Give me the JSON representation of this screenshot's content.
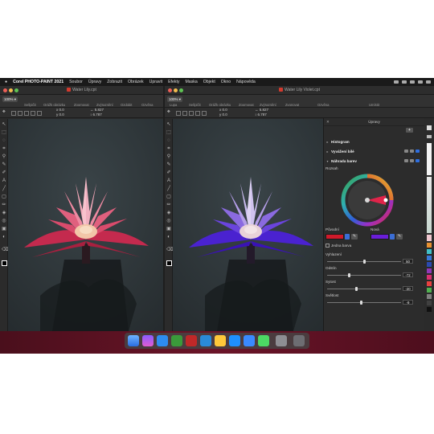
{
  "menubar": {
    "app_name": "Corel PHOTO-PAINT 2021",
    "items": [
      "Soubor",
      "Úpravy",
      "Zobrazit",
      "Obrázek",
      "Upravit",
      "Efekty",
      "Maska",
      "Objekt",
      "Okno",
      "Nápověda"
    ]
  },
  "left_window": {
    "title": "Water Lily.cpt",
    "zoom": "100%",
    "toolbar_labels": [
      "Sešpičit",
      "Orážk obrázku",
      "Zoomovat",
      "Zvýraznění",
      "Ozdobit",
      "Ozvěna"
    ],
    "props": {
      "x": "0.0",
      "y": "0.0",
      "w": "5.827",
      "h": "6.787"
    }
  },
  "right_window": {
    "title": "Water Lily Violet.cpt",
    "zoom": "100%",
    "toolbar_labels": [
      "Lupa",
      "Sešpičit",
      "Orážk obrázku",
      "Zoomovat",
      "Zvýraznění",
      "Zvonovat",
      "Ozvěna",
      "Umístit"
    ],
    "props": {
      "x": "0.0",
      "y": "0.0",
      "w": "5.827",
      "h": "6.787"
    }
  },
  "adjustments": {
    "title": "Úpravy",
    "items": [
      {
        "label": "Histogram"
      },
      {
        "label": "Vyvážení bílé"
      },
      {
        "label": "Náhrada barev"
      }
    ],
    "range_label": "Rozsah",
    "old_label": "Původní",
    "new_label": "Nová",
    "old_color": "#d01a2a",
    "new_color": "#6a1ed8",
    "single_color_label": "Jedna barva",
    "sliders": [
      {
        "label": "Vyhlazení",
        "value": "50",
        "fraction": 0.5
      },
      {
        "label": "Odstín",
        "value": "-72",
        "fraction": 0.3
      },
      {
        "label": "Sytost",
        "value": "-20",
        "fraction": 0.4
      },
      {
        "label": "Světlost",
        "value": "-9",
        "fraction": 0.46
      }
    ]
  }
}
